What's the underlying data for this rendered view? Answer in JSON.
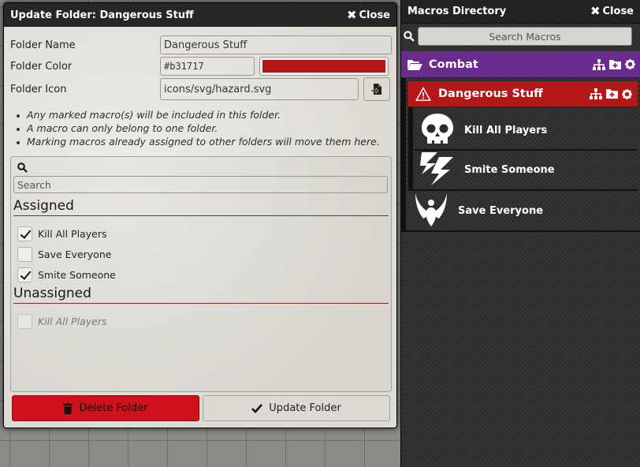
{
  "dialog": {
    "title": "Update Folder: Dangerous Stuff",
    "close_label": "Close",
    "fields": {
      "name_label": "Folder Name",
      "name_value": "Dangerous Stuff",
      "color_label": "Folder Color",
      "color_value": "#b31717",
      "icon_label": "Folder Icon",
      "icon_value": "icons/svg/hazard.svg"
    },
    "notes": [
      "Any marked macro(s) will be included in this folder.",
      "A macro can only belong to one folder.",
      "Marking macros already assigned to other folders will move them here."
    ],
    "search_placeholder": "Search",
    "assigned_title": "Assigned",
    "assigned": [
      {
        "label": "Kill All Players",
        "checked": true
      },
      {
        "label": "Save Everyone",
        "checked": false
      },
      {
        "label": "Smite Someone",
        "checked": true
      }
    ],
    "unassigned_title": "Unassigned",
    "unassigned": [
      {
        "label": "Kill All Players",
        "checked": false
      }
    ],
    "delete_label": "Delete Folder",
    "update_label": "Update Folder"
  },
  "sidebar": {
    "title": "Macros Directory",
    "close_label": "Close",
    "search_placeholder": "Search Macros",
    "folders": [
      {
        "name": "Combat",
        "color": "#6a2c8c",
        "icon": "folder-open-icon"
      },
      {
        "name": "Dangerous Stuff",
        "color": "#b31717",
        "icon": "hazard-icon"
      }
    ],
    "macros": [
      {
        "name": "Kill All Players",
        "icon": "skull-icon"
      },
      {
        "name": "Smite Someone",
        "icon": "lightning-icon"
      },
      {
        "name": "Save Everyone",
        "icon": "angel-wings-icon"
      }
    ]
  },
  "colors": {
    "danger_red": "#b31717",
    "combat_purple": "#6a2c8c",
    "delete_red": "#d0111b"
  }
}
